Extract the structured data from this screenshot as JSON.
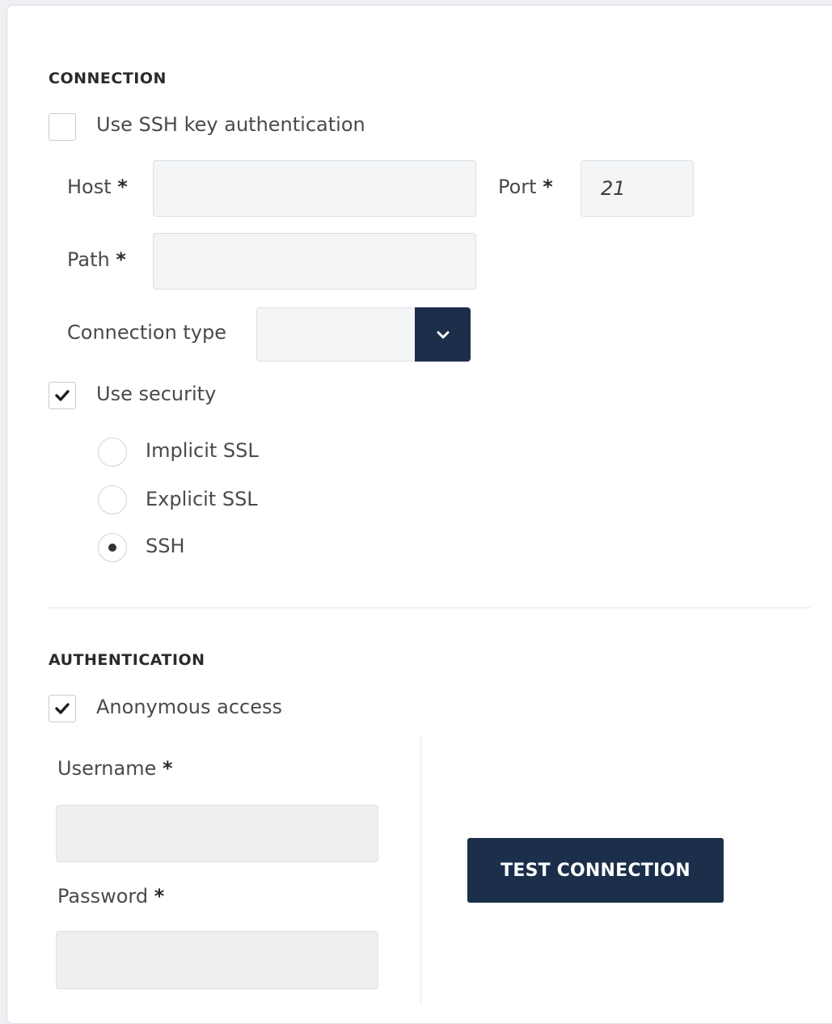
{
  "connection": {
    "section_title": "CONNECTION",
    "ssh_key_auth": {
      "label": "Use SSH key authentication",
      "checked": false
    },
    "host": {
      "label": "Host",
      "required_mark": "*",
      "value": ""
    },
    "port": {
      "label": "Port",
      "required_mark": "*",
      "value": "21"
    },
    "path": {
      "label": "Path",
      "required_mark": "*",
      "value": ""
    },
    "connection_type": {
      "label": "Connection type",
      "selected": "",
      "icon": "chevron-down-icon"
    },
    "use_security": {
      "label": "Use security",
      "checked": true
    },
    "security_options": [
      {
        "label": "Implicit SSL",
        "selected": false
      },
      {
        "label": "Explicit SSL",
        "selected": false
      },
      {
        "label": "SSH",
        "selected": true
      }
    ]
  },
  "authentication": {
    "section_title": "AUTHENTICATION",
    "anonymous_access": {
      "label": "Anonymous access",
      "checked": true
    },
    "username": {
      "label": "Username",
      "required_mark": "*",
      "value": ""
    },
    "password": {
      "label": "Password",
      "required_mark": "*",
      "value": ""
    },
    "test_button": {
      "label": "TEST CONNECTION"
    }
  },
  "colors": {
    "primary": "#1b2f4b",
    "input_bg": "#f4f5f6",
    "border": "#dcdfe3"
  }
}
